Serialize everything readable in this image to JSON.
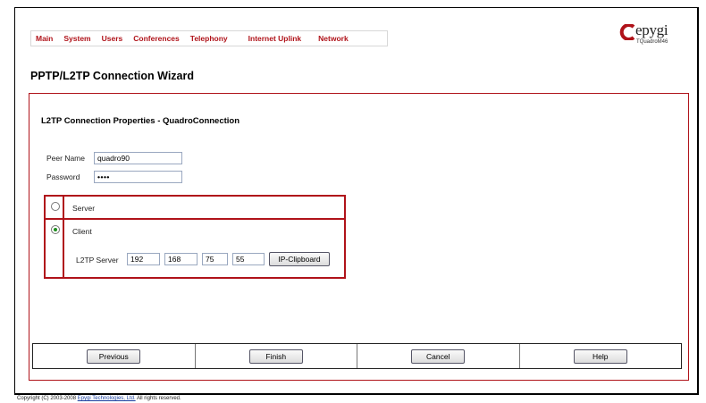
{
  "nav": [
    "Main",
    "System",
    "Users",
    "Conferences",
    "Telephony",
    "Internet Uplink",
    "Network"
  ],
  "logo": {
    "word": "epygi",
    "model": "TQuadroM46"
  },
  "page_title": "PPTP/L2TP Connection Wizard",
  "section_title": "L2TP Connection Properties - QuadroConnection",
  "form": {
    "peer_name_label": "Peer Name",
    "peer_name_value": "quadro90",
    "password_label": "Password",
    "password_value": "••••"
  },
  "mode": {
    "server_label": "Server",
    "client_label": "Client",
    "selected": "Client",
    "l2tp_server_label": "L2TP Server",
    "ip": [
      "192",
      "168",
      "75",
      "55"
    ],
    "clipboard_button": "IP-Clipboard"
  },
  "buttons": {
    "previous": "Previous",
    "finish": "Finish",
    "cancel": "Cancel",
    "help": "Help"
  },
  "footer": {
    "prefix": "Copyright (C) 2003-2008 ",
    "company": "Epygi Technologies, Ltd.",
    "suffix": " All rights reserved."
  },
  "colors": {
    "accent": "#b0131a",
    "radio_selected": "#1f8f1f"
  },
  "icons": {
    "logo": "epygi-logo-icon"
  }
}
